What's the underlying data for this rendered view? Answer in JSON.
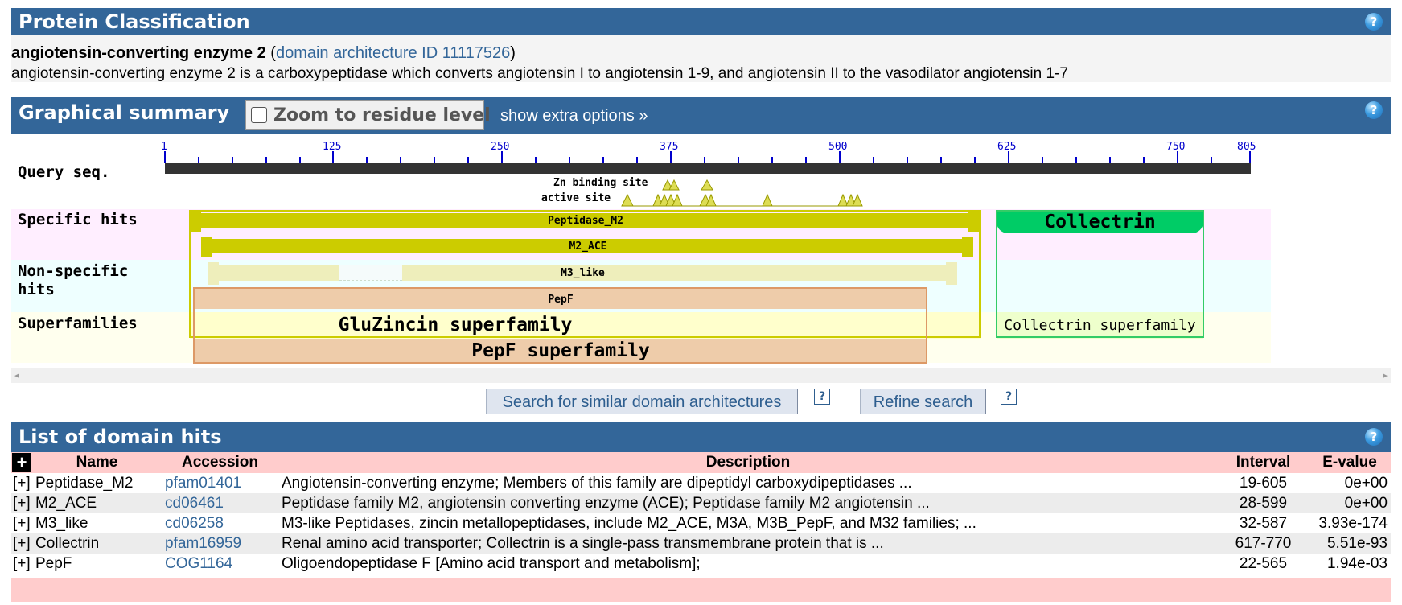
{
  "classification": {
    "title": "Protein Classification",
    "help": "?",
    "protein_name": "angiotensin-converting enzyme 2",
    "arch_prefix": " (",
    "arch_link": "domain architecture ID 11117526",
    "arch_suffix": ")",
    "description": "angiotensin-converting enzyme 2 is a carboxypeptidase which converts angiotensin I to angiotensin 1-9, and angiotensin II to the vasodilator angiotensin 1-7"
  },
  "graphical": {
    "title": "Graphical summary",
    "zoom_label": "Zoom to residue level",
    "zoom_checked": false,
    "extra_options": "show extra options »",
    "help": "?",
    "ruler_ticks": [
      "1",
      "125",
      "250",
      "375",
      "500",
      "625",
      "750",
      "805"
    ],
    "row_labels": {
      "query": "Query seq.",
      "specific": "Specific hits",
      "nonspecific_1": "Non-specific",
      "nonspecific_2": "hits",
      "superfamilies": "Superfamilies"
    },
    "site_labels": {
      "zn": "Zn binding site",
      "active": "active site"
    },
    "domains": {
      "peptidase_m2": "Peptidase_M2",
      "m2_ace": "M2_ACE",
      "collectrin": "Collectrin",
      "m3_like": "M3_like",
      "pepf": "PepF",
      "gluzincin_sf": "GluZincin superfamily",
      "collectrin_sf": "Collectrin superfamily",
      "pepf_sf": "PepF superfamily"
    }
  },
  "actions": {
    "search_similar": "Search for similar domain architectures",
    "refine": "Refine search",
    "help": "?"
  },
  "hits": {
    "title": "List of domain hits",
    "help": "?",
    "expand_all": "+",
    "columns": [
      "Name",
      "Accession",
      "Description",
      "Interval",
      "E-value"
    ],
    "rows": [
      {
        "toggle": "[+]",
        "name": "Peptidase_M2",
        "accession": "pfam01401",
        "description": "Angiotensin-converting enzyme; Members of this family are dipeptidyl carboxydipeptidases ...",
        "interval": "19-605",
        "evalue": "0e+00"
      },
      {
        "toggle": "[+]",
        "name": "M2_ACE",
        "accession": "cd06461",
        "description": "Peptidase family M2, angiotensin converting enzyme (ACE); Peptidase family M2 angiotensin ...",
        "interval": "28-599",
        "evalue": "0e+00"
      },
      {
        "toggle": "[+]",
        "name": "M3_like",
        "accession": "cd06258",
        "description": "M3-like Peptidases, zincin metallopeptidases, include M2_ACE, M3A, M3B_PepF, and M32 families; ...",
        "interval": "32-587",
        "evalue": "3.93e-174"
      },
      {
        "toggle": "[+]",
        "name": "Collectrin",
        "accession": "pfam16959",
        "description": "Renal amino acid transporter; Collectrin is a single-pass transmembrane protein that is ...",
        "interval": "617-770",
        "evalue": "5.51e-93"
      },
      {
        "toggle": "[+]",
        "name": "PepF",
        "accession": "COG1164",
        "description": "Oligoendopeptidase F [Amino acid transport and metabolism];",
        "interval": "22-565",
        "evalue": "1.94e-03"
      }
    ]
  },
  "colors": {
    "header_bar": "#336699",
    "specific_bg": "#ffeeff",
    "nonspecific_bg": "#eeffff",
    "superfamily_bg": "#ffffee",
    "specific_domain": "#cccc00",
    "nonspecific_domain": "#eeeebb",
    "collectrin": "#00cc66",
    "pepf": "#eeccaa",
    "table_header": "#ffcccc"
  }
}
